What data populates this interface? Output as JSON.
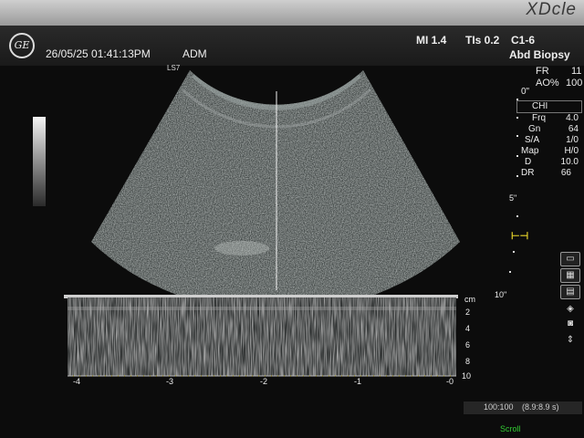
{
  "bezel": {
    "brand": "XDcle"
  },
  "header": {
    "logo_text": "GE",
    "datetime": "26/05/25 01:41:13PM",
    "operator": "ADM",
    "mi": "MI 1.4",
    "tis": "TIs 0.2",
    "probe": "C1-6",
    "preset": "Abd Biopsy",
    "image_label": "LS7"
  },
  "acq": {
    "fr_label": "FR",
    "fr_value": "11",
    "ao_label": "AO%",
    "ao_value": "100",
    "zero_mark": "0\""
  },
  "params": {
    "title": "CHI",
    "rows": [
      {
        "label": "Frq",
        "value": "4.0"
      },
      {
        "label": "Gn",
        "value": "64"
      },
      {
        "label": "S/A",
        "value": "1/0"
      },
      {
        "label": "Map",
        "value": "H/0"
      },
      {
        "label": "D",
        "value": "10.0"
      },
      {
        "label": "DR",
        "value": "66"
      }
    ]
  },
  "depth_scale": {
    "mark_5": "5\"",
    "mark_10": "10\"",
    "focus_marker": "⊢⊣"
  },
  "mmode": {
    "unit": "cm",
    "depth_ticks": [
      "2",
      "4",
      "6",
      "8",
      "10"
    ],
    "time_ticks": [
      "-4",
      "-3",
      "-2",
      "-1",
      "-0"
    ]
  },
  "footer": {
    "ratio": "100:100",
    "fov": "(8.9:8.9 s)",
    "scroll": "Scroll"
  },
  "side_icons": [
    "monitor-icon",
    "calculator-icon",
    "grid-icon",
    "zoom-icon",
    "camera-icon",
    "arrows-icon"
  ],
  "colors": {
    "background": "#0c0c0c",
    "focus_marker": "#e6d22a",
    "scroll_text": "#33cc33"
  }
}
